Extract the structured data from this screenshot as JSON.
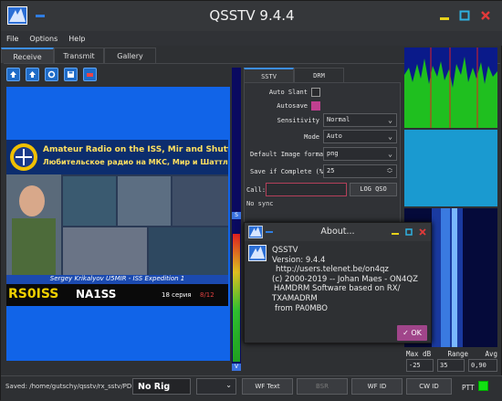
{
  "window": {
    "title": "QSSTV 9.4.4"
  },
  "menu": [
    "File",
    "Options",
    "Help"
  ],
  "tabs": [
    "Receive",
    "Transmit",
    "Gallery"
  ],
  "image_banner": {
    "line1": "Amateur Radio on the ISS, Mir and Shuttle",
    "line2": "Любительское радио на МКС, Мир и Шаттл",
    "caption": "Sergey Krikalyov U5MIR - ISS Expedition 1",
    "callsign_left": "RS0ISS",
    "callsign_right": "NA1SS",
    "series": "18 серия",
    "page": "8/12"
  },
  "vumeter": {
    "mark_top": "S",
    "mark_bottom": "V"
  },
  "panel_tabs": [
    "SSTV",
    "DRM"
  ],
  "settings": {
    "auto_slant_label": "Auto Slant",
    "autosave_label": "Autosave",
    "sensitivity_label": "Sensitivity",
    "sensitivity_value": "Normal",
    "mode_label": "Mode",
    "mode_value": "Auto",
    "image_format_label": "Default Image format",
    "image_format_value": "png",
    "save_complete_label": "Save if Complete (%)",
    "save_complete_value": "25",
    "call_label": "Call:",
    "log_qso_label": "LOG QSO",
    "sync_status": "No sync"
  },
  "spectrum_controls": {
    "labels": [
      "Max dB",
      "Range",
      "Avg"
    ],
    "max_db": "-25",
    "range": "35",
    "avg": "0,90"
  },
  "about": {
    "title": "About...",
    "app": "QSSTV",
    "version": "Version: 9.4.4",
    "url": "http://users.telenet.be/on4qz",
    "copyright": "(c) 2000-2019 -- Johan Maes - ON4QZ",
    "hamdrm": "HAMDRM Software based on RX/",
    "txamadrm": "TXAMADRM",
    "from": "from PA0MBO",
    "ok": "OK"
  },
  "statusbar": {
    "saved_path": "Saved: /home/gutschy/qsstv/rx_sstv/PD180",
    "rig": "No Rig",
    "wf_text": "WF Text",
    "bsr": "BSR",
    "wf_id": "WF ID",
    "cw_id": "CW ID",
    "ptt": "PTT"
  },
  "colors": {
    "accent": "#3d8ee8",
    "ok_button": "#a0458a",
    "ptt_led": "#12e012"
  }
}
